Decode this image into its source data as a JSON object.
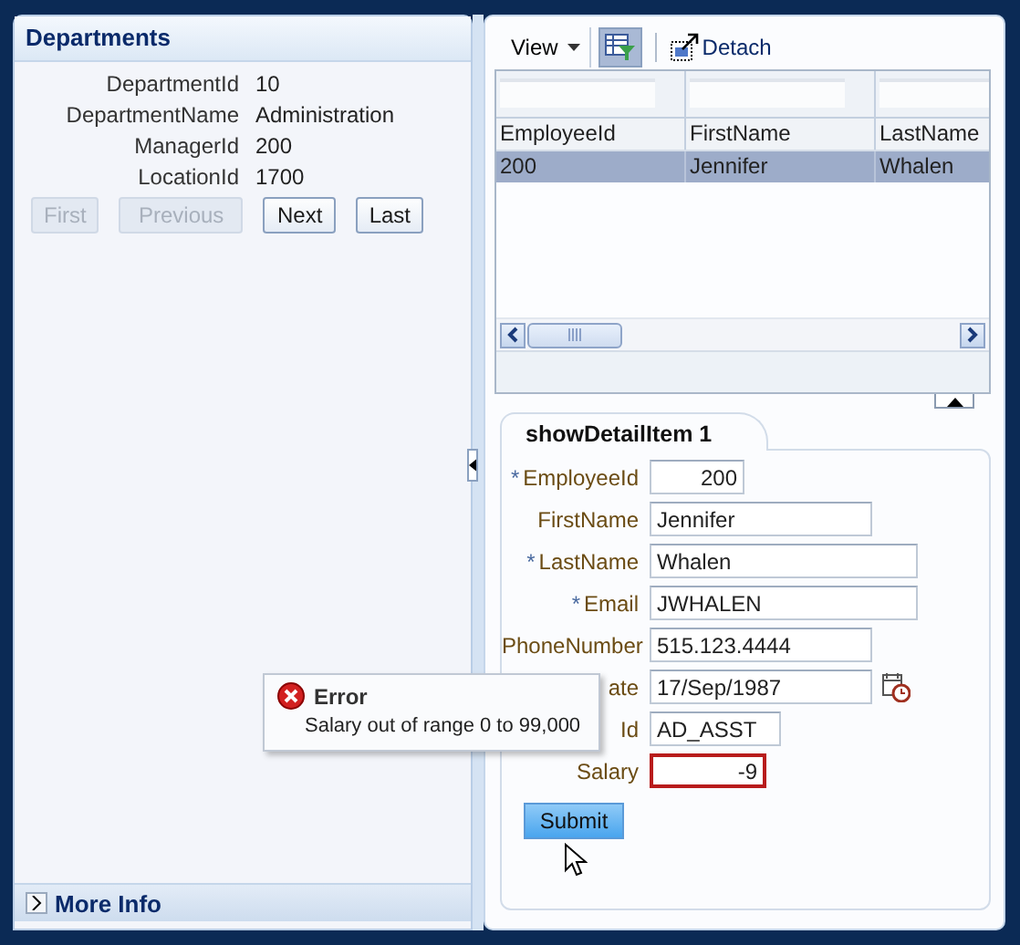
{
  "departments": {
    "title": "Departments",
    "fields": [
      {
        "label": "DepartmentId",
        "value": "10"
      },
      {
        "label": "DepartmentName",
        "value": "Administration"
      },
      {
        "label": "ManagerId",
        "value": "200"
      },
      {
        "label": "LocationId",
        "value": "1700"
      }
    ],
    "buttons": [
      {
        "label": "First",
        "disabled": true
      },
      {
        "label": "Previous",
        "disabled": true
      },
      {
        "label": "Next",
        "disabled": false
      },
      {
        "label": "Last",
        "disabled": false
      }
    ],
    "more_info": {
      "label": "More Info",
      "expanded": false
    }
  },
  "employees": {
    "toolbar": {
      "view_menu": "View",
      "detach": "Detach"
    },
    "columns": [
      "EmployeeId",
      "FirstName",
      "LastName"
    ],
    "rows": [
      {
        "cells": [
          "200",
          "Jennifer",
          "Whalen"
        ],
        "selected": true
      }
    ]
  },
  "detail": {
    "tab": {
      "label": "showDetailItem 1",
      "selected": true
    },
    "fields": [
      {
        "label": "EmployeeId",
        "value": "200",
        "required_mark": "*",
        "kind": "number",
        "error": false
      },
      {
        "label": "FirstName",
        "value": "Jennifer",
        "kind": "text",
        "error": false
      },
      {
        "label": "LastName",
        "value": "Whalen",
        "required_mark": "*",
        "kind": "text",
        "error": false
      },
      {
        "label": "Email",
        "value": "JWHALEN",
        "required_mark": "*",
        "kind": "text",
        "error": false
      },
      {
        "label": "PhoneNumber",
        "value": "515.123.4444",
        "kind": "text",
        "error": false
      },
      {
        "label": "ate",
        "value": "17/Sep/1987",
        "kind": "date",
        "error": false
      },
      {
        "label": "Id",
        "value": "AD_ASST",
        "kind": "text",
        "error": false
      },
      {
        "label": "Salary",
        "value": "-9",
        "kind": "number",
        "error": true
      }
    ],
    "submit": "Submit"
  },
  "error_popup": {
    "title": "Error",
    "message": "Salary out of range 0 to 99,000"
  }
}
